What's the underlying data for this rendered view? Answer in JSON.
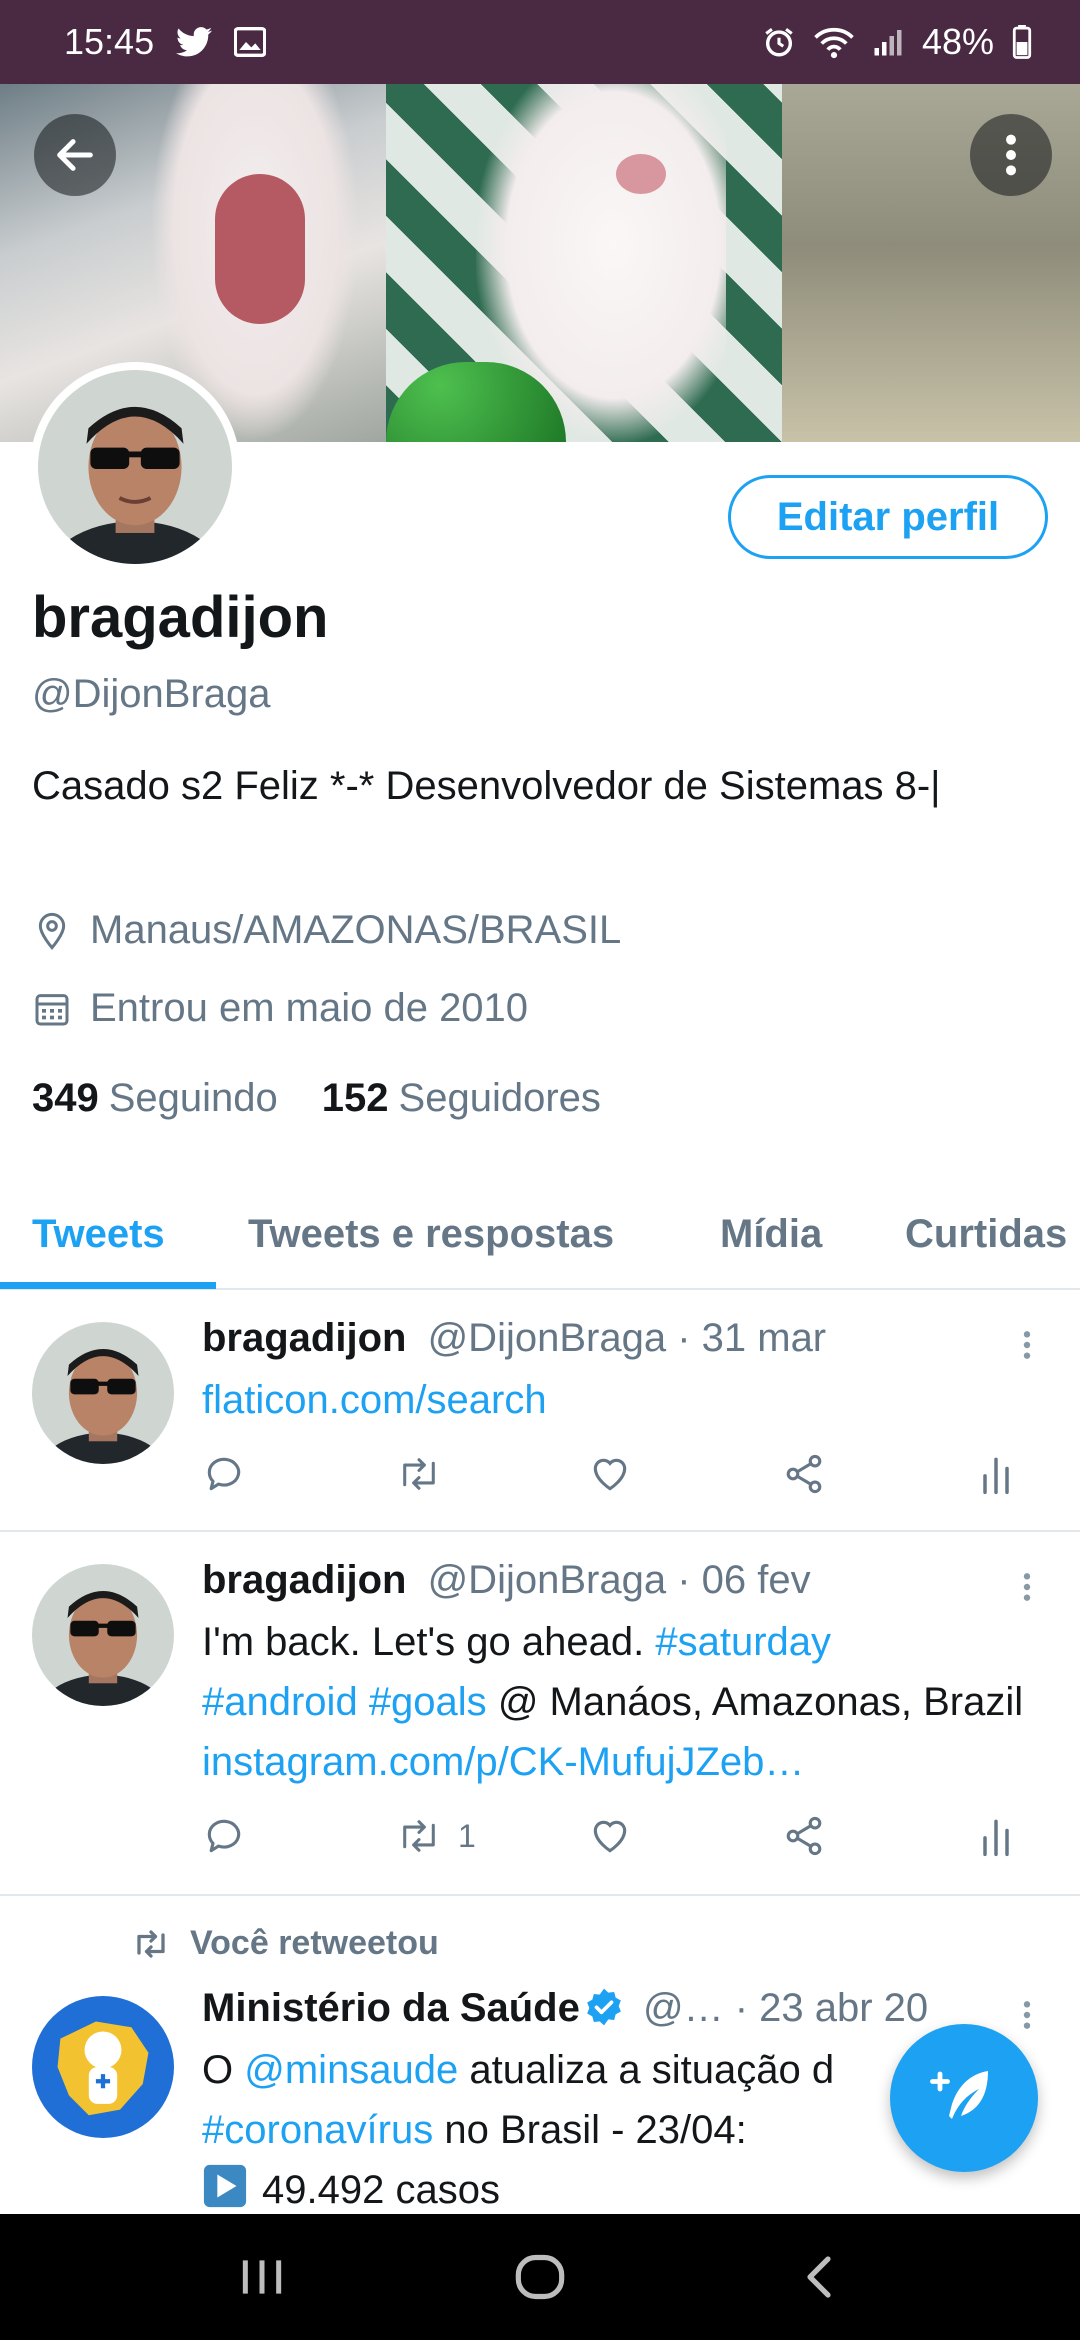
{
  "status_bar": {
    "time": "15:45",
    "battery": "48%",
    "icons": [
      "twitter-icon",
      "image-icon",
      "alarm-icon",
      "wifi-icon",
      "signal-icon",
      "battery-icon"
    ]
  },
  "header": {
    "back_icon": "arrow-left-icon",
    "more_icon": "more-vertical-icon"
  },
  "profile": {
    "edit_label": "Editar perfil",
    "display_name": "bragadijon",
    "handle": "@DijonBraga",
    "bio": "Casado s2  Feliz *-* Desenvolvedor de Sistemas 8-|",
    "location": "Manaus/AMAZONAS/BRASIL",
    "joined": "Entrou em maio de 2010",
    "following_count": "349",
    "following_label": "Seguindo",
    "followers_count": "152",
    "followers_label": "Seguidores"
  },
  "tabs": [
    {
      "label": "Tweets",
      "active": true
    },
    {
      "label": "Tweets e respostas",
      "active": false
    },
    {
      "label": "Mídia",
      "active": false
    },
    {
      "label": "Curtidas",
      "active": false
    }
  ],
  "tweets": [
    {
      "name": "bragadijon",
      "handle": "@DijonBraga",
      "date": "· 31 mar",
      "link": "flaticon.com/search",
      "retweets": ""
    },
    {
      "name": "bragadijon",
      "handle": "@DijonBraga",
      "date": "· 06 fev",
      "text_1": "I'm back. Let's go ahead.",
      "tag_1": "#saturday",
      "tag_2": "#android",
      "tag_3": "#goals",
      "text_2": "@ Manáos, Amazonas, Brazil",
      "link": "instagram.com/p/CK-MufujJZeb…",
      "retweets": "1"
    },
    {
      "retweeted_label": "Você retweetou",
      "name": "Ministério da Saúde",
      "handle": "@…",
      "date": "· 23 abr 20",
      "text_1": "O",
      "mention": "@minsaude",
      "text_2": "atualiza a situação d",
      "tag_1": "#coronavírus",
      "text_3": "no Brasil - 23/04:",
      "text_4": "49.492 casos"
    }
  ],
  "colors": {
    "accent": "#1da1f2",
    "status_bar": "#4a2a43",
    "secondary_text": "#657786"
  }
}
